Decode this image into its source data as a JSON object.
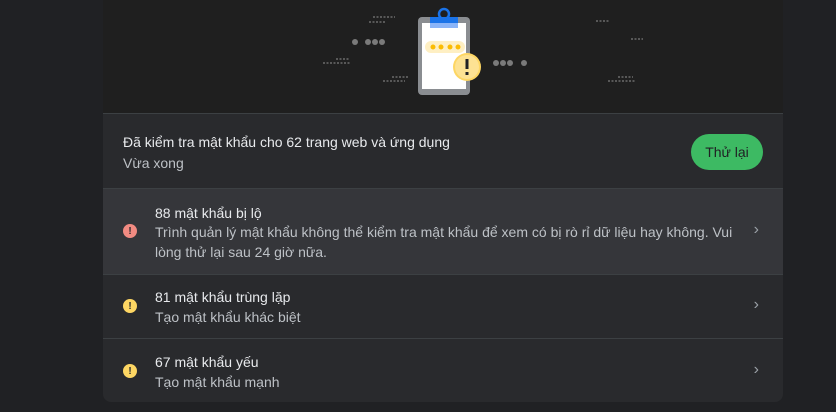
{
  "status": {
    "title": "Đã kiểm tra mật khẩu cho 62 trang web và ứng dụng",
    "subtitle": "Vừa xong",
    "retry_label": "Thử lại"
  },
  "issues": [
    {
      "title": "88 mật khẩu bị lộ",
      "description": "Trình quản lý mật khẩu không thể kiểm tra mật khẩu để xem có bị rò rỉ dữ liệu hay không. Vui lòng thử lại sau 24 giờ nữa.",
      "icon": "error-icon",
      "color": "#f28b82"
    },
    {
      "title": "81 mật khẩu trùng lặp",
      "description": "Tạo mật khẩu khác biệt",
      "icon": "warning-icon",
      "color": "#fdd663"
    },
    {
      "title": "67 mật khẩu yếu",
      "description": "Tạo mật khẩu mạnh",
      "icon": "warning-icon",
      "color": "#fdd663"
    }
  ],
  "colors": {
    "accent": "#3dba63",
    "error": "#f28b82",
    "warning": "#fdd663"
  }
}
